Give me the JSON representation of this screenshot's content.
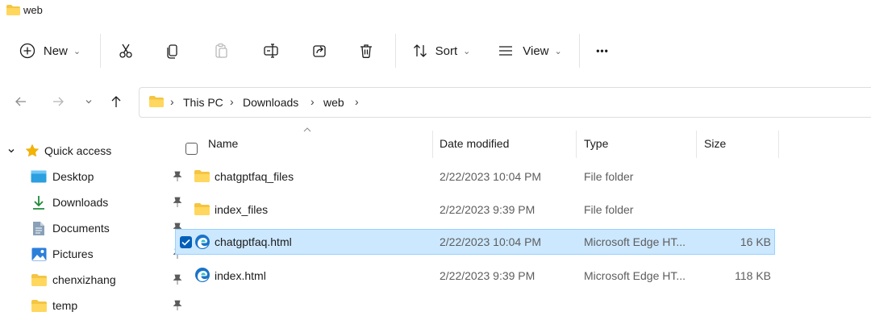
{
  "window": {
    "title": "web"
  },
  "toolbar": {
    "new_label": "New",
    "sort_label": "Sort",
    "view_label": "View",
    "more_label": "•••"
  },
  "address": {
    "crumbs": [
      "This PC",
      "Downloads",
      "web"
    ]
  },
  "sidebar": {
    "quick_access": "Quick access",
    "items": [
      {
        "label": "Desktop",
        "icon": "desktop-icon",
        "pinned": true
      },
      {
        "label": "Downloads",
        "icon": "download-icon",
        "pinned": true
      },
      {
        "label": "Documents",
        "icon": "documents-icon",
        "pinned": true
      },
      {
        "label": "Pictures",
        "icon": "pictures-icon",
        "pinned": true
      },
      {
        "label": "chenxizhang",
        "icon": "folder-icon",
        "pinned": true
      },
      {
        "label": "temp",
        "icon": "folder-icon",
        "pinned": true
      }
    ]
  },
  "columns": {
    "name": "Name",
    "date": "Date modified",
    "type": "Type",
    "size": "Size"
  },
  "files": [
    {
      "name": "chatgptfaq_files",
      "date": "2/22/2023 10:04 PM",
      "type": "File folder",
      "size": "",
      "icon": "folder-icon",
      "selected": false
    },
    {
      "name": "index_files",
      "date": "2/22/2023 9:39 PM",
      "type": "File folder",
      "size": "",
      "icon": "folder-icon",
      "selected": false
    },
    {
      "name": "chatgptfaq.html",
      "date": "2/22/2023 10:04 PM",
      "type": "Microsoft Edge HT...",
      "size": "16 KB",
      "icon": "edge-icon",
      "selected": true
    },
    {
      "name": "index.html",
      "date": "2/22/2023 9:39 PM",
      "type": "Microsoft Edge HT...",
      "size": "118 KB",
      "icon": "edge-icon",
      "selected": false
    }
  ],
  "colors": {
    "accent": "#005fb8",
    "folder": "#f4c542",
    "selection_bg": "#cce8ff",
    "selection_border": "#99d1ff"
  }
}
